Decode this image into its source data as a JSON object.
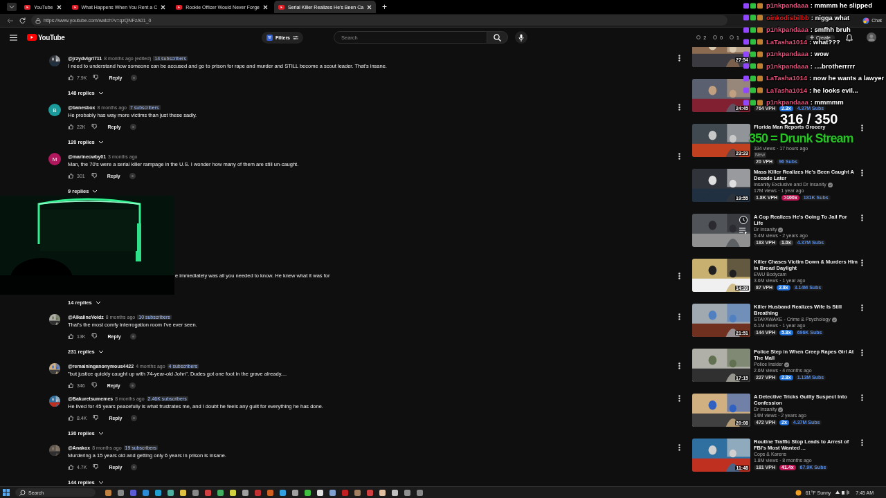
{
  "browser": {
    "tabs": [
      {
        "label": "YouTube",
        "selected": false
      },
      {
        "label": "What Happens When You Rent a C",
        "selected": false
      },
      {
        "label": "Rookie Officer Would Never Forge",
        "selected": false
      },
      {
        "label": "Serial Killer Realizes He's Been Ca",
        "selected": true
      }
    ],
    "new_tab": "+",
    "url": "https://www.youtube.com/watch?v=qzQNFzA01_0",
    "chat_button": "Chat"
  },
  "header": {
    "logo": "YouTube",
    "filters": "Filters",
    "search": {
      "placeholder": "Search"
    },
    "counters": [
      "2",
      "0",
      "1"
    ],
    "create": "Create"
  },
  "comments": [
    {
      "kind": "full",
      "handle": "@jrzydvlgrl711",
      "time": "8 months ago (edited)",
      "badge": "14 subscribers",
      "text": "I need to understand how someone can be accused and go to prison for rape and murder and STILL become a scout leader. That's insane.",
      "likes": "7.9K",
      "reply": "Reply",
      "replies": "148 replies"
    },
    {
      "kind": "full",
      "avatar": {
        "kind": "letter",
        "letter": "B",
        "color": "#1a9a9a"
      },
      "handle": "@banesbox",
      "time": "8 months ago",
      "badge": "7 subscribers",
      "text": "He probably has way more victims than just these sadly.",
      "likes": "22K",
      "reply": "Reply",
      "replies": "120 replies"
    },
    {
      "kind": "full",
      "avatar": {
        "kind": "letter",
        "letter": "M",
        "color": "#b0175c"
      },
      "handle": "@marinecwby01",
      "time": "3 months ago",
      "text": "Man, the 70's were a serial killer rampage in the U.S.  I wonder how many of them are still un-caught.",
      "likes": "301",
      "reply": "Reply",
      "replies": "9 replies"
    },
    {
      "kind": "partial",
      "text": "e immediately was all you needed to know. He knew what it was for",
      "replies": "14 replies"
    },
    {
      "kind": "full",
      "handle": "@AlkalineVoidz",
      "time": "8 months ago",
      "badge": "10 subscribers",
      "text": "That's the most comfy interrogation room I've ever seen.",
      "likes": "13K",
      "reply": "Reply",
      "replies": "231 replies"
    },
    {
      "kind": "full",
      "handle": "@remaininganonymous4422",
      "time": "4 months ago",
      "badge": "4 subscribers",
      "text": "\"but justice quickly caught up with 74-year-old John\". Dudes got one foot in the grave already....",
      "likes": "346",
      "reply": "Reply"
    },
    {
      "kind": "full",
      "handle": "@Bakuretsumemes",
      "time": "8 months ago",
      "badge": "2.46K subscribers",
      "text": "He lived for 45 years peacefully is what frustrates me, and I doubt he feels any guilt for everything he has done.",
      "likes": "8.4K",
      "reply": "Reply",
      "replies": "130 replies"
    },
    {
      "kind": "full",
      "handle": "@Anakox",
      "time": "8 months ago",
      "badge": "19 subscribers",
      "text": "Murdering a 15 years old and getting only 6 years in prison is insane.",
      "likes": "4.7K",
      "reply": "Reply",
      "replies": "144 replies"
    }
  ],
  "videos": [
    {
      "duration": "27:54"
    },
    {
      "duration": "24:45",
      "stats": {
        "vph": "764 VPH",
        "multiplier": "2.3x",
        "color": "#1f6fd6",
        "subs": "4.37M Subs"
      }
    },
    {
      "title": "Florida Man Reports Grocery",
      "duration": "23:23",
      "meta": "334 views · 17 hours ago",
      "tag": "New",
      "stats": {
        "vph": "20 VPH",
        "subs": "96 Subs"
      }
    },
    {
      "title": "Mass Killer Realizes He's Been Caught A Decade Later",
      "duration": "19:55",
      "channel": "Insanity Exclusive and Dr Insanity",
      "verified": true,
      "meta": "17M views · 1 year ago",
      "stats": {
        "vph": "1.8K VPH",
        "multiplier": ">100x",
        "color": "#b8124f",
        "subs": "181K Subs"
      }
    },
    {
      "title": "A Cop Realizes He's Going To Jail For Life",
      "channel": "Dr Insanity",
      "verified": true,
      "meta": "5.4M views · 2 years ago",
      "hover": true,
      "stats": {
        "vph": "183 VPH",
        "multiplier": "1.0x",
        "color": "#3a3a3a",
        "subs": "4.37M Subs"
      }
    },
    {
      "title": "Killer Chases Victim Down & Murders Him in Broad Daylight",
      "duration": "14:39",
      "channel": "EWU Bodycam",
      "meta": "3.6M views · 1 year ago",
      "stats": {
        "vph": "87 VPH",
        "multiplier": "2.8x",
        "color": "#1f6fd6",
        "subs": "3.14M Subs"
      }
    },
    {
      "title": "Killer Husband Realizes Wife Is Still Breathing",
      "duration": "21:51",
      "channel": "STAYAWAKE - Crime & Psychology",
      "verified": true,
      "meta": "6.1M views · 1 year ago",
      "stats": {
        "vph": "144 VPH",
        "multiplier": "5.8x",
        "color": "#1f6fd6",
        "subs": "696K Subs"
      }
    },
    {
      "title": "Police Step in When Creep Rapes Girl At The Mall",
      "duration": "17:15",
      "channel": "Police Insider",
      "verified": true,
      "meta": "2.6M views · 4 months ago",
      "stats": {
        "vph": "227 VPH",
        "multiplier": "2.8x",
        "color": "#1f6fd6",
        "subs": "1.13M Subs"
      }
    },
    {
      "title": "A Detective Tricks Guilty Suspect Into Confession",
      "duration": "20:08",
      "channel": "Dr Insanity",
      "verified": true,
      "meta": "14M views · 2 years ago",
      "stats": {
        "vph": "472 VPH",
        "multiplier": "2x",
        "color": "#1f6fd6",
        "subs": "4.37M Subs"
      }
    },
    {
      "title": "Routine Traffic Stop Leads to Arrest of FBI's Most Wanted ...",
      "duration": "11:48",
      "channel": "Cops & Karens",
      "meta": "1.8M views · 8 months ago",
      "stats": {
        "vph": "181 VPH",
        "multiplier": "41.4x",
        "color": "#b8124f",
        "subs": "67.9K Subs"
      }
    }
  ],
  "chat": [
    {
      "user": "p1nkpandaaa",
      "color": "#e0507a",
      "text": ": mmmm he slipped"
    },
    {
      "user": "oinkodisbilbb",
      "color": "#e02020",
      "text": ": nigga what"
    },
    {
      "user": "p1nkpandaaa",
      "color": "#e0507a",
      "text": ": smfhh bruh"
    },
    {
      "user": "LaTasha1014",
      "color": "#e0507a",
      "text": ": what???"
    },
    {
      "user": "p1nkpandaaa",
      "color": "#e0507a",
      "text": ": wow"
    },
    {
      "user": "p1nkpandaaa",
      "color": "#e0507a",
      "text": ": ....brotherrrrr"
    },
    {
      "user": "LaTasha1014",
      "color": "#e0507a",
      "text": ": now he wants a lawyer"
    },
    {
      "user": "LaTasha1014",
      "color": "#e0507a",
      "text": ": he looks evil..."
    },
    {
      "user": "p1nkpandaaa",
      "color": "#e0507a",
      "text": ": mmmmm"
    }
  ],
  "goal": {
    "count": "316 / 350",
    "label": "350 = Drunk Stream"
  },
  "taskbar": {
    "search": "Search",
    "weather": "61°F Sunny",
    "time": "7:45 AM"
  }
}
